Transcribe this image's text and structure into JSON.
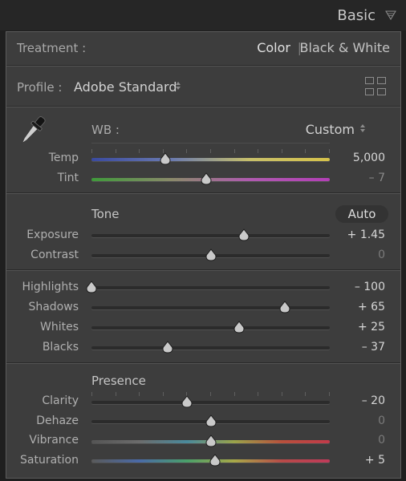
{
  "header": {
    "title": "Basic"
  },
  "treatment": {
    "label": "Treatment :",
    "options": [
      "Color",
      "Black & White"
    ],
    "selected": "Color"
  },
  "profile": {
    "label": "Profile :",
    "value": "Adobe Standard"
  },
  "wb": {
    "label": "WB :",
    "value": "Custom"
  },
  "sliders": {
    "temp": {
      "label": "Temp",
      "value": "5,000",
      "position": 0.31
    },
    "tint": {
      "label": "Tint",
      "value": "– 7",
      "position": 0.48
    },
    "exposure": {
      "label": "Exposure",
      "value": "+ 1.45",
      "position": 0.64
    },
    "contrast": {
      "label": "Contrast",
      "value": "0",
      "position": 0.5
    },
    "highlights": {
      "label": "Highlights",
      "value": "– 100",
      "position": 0.0
    },
    "shadows": {
      "label": "Shadows",
      "value": "+ 65",
      "position": 0.81
    },
    "whites": {
      "label": "Whites",
      "value": "+ 25",
      "position": 0.62
    },
    "blacks": {
      "label": "Blacks",
      "value": "– 37",
      "position": 0.32
    },
    "clarity": {
      "label": "Clarity",
      "value": "– 20",
      "position": 0.4
    },
    "dehaze": {
      "label": "Dehaze",
      "value": "0",
      "position": 0.5
    },
    "vibrance": {
      "label": "Vibrance",
      "value": "0",
      "position": 0.5
    },
    "saturation": {
      "label": "Saturation",
      "value": "+ 5",
      "position": 0.52
    }
  },
  "tone": {
    "title": "Tone",
    "auto_label": "Auto"
  },
  "presence": {
    "title": "Presence"
  },
  "icons": {
    "header": "collapse-triangle-icon",
    "profile_browser": "grid-icon",
    "white_balance": "eyedropper-icon"
  }
}
